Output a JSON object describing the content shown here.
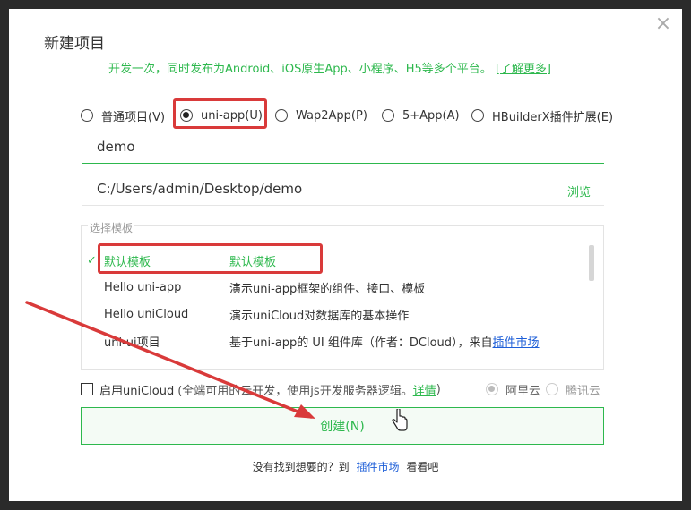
{
  "dialog": {
    "title": "新建项目",
    "subtitle": "开发一次，同时发布为Android、iOS原生App、小程序、H5等多个平台。",
    "learn_more": "[了解更多]",
    "close_icon": "×"
  },
  "project_types": [
    {
      "label": "普通项目(V)",
      "checked": false
    },
    {
      "label": "uni-app(U)",
      "checked": true
    },
    {
      "label": "Wap2App(P)",
      "checked": false
    },
    {
      "label": "5+App(A)",
      "checked": false
    },
    {
      "label": "HBuilderX插件扩展(E)",
      "checked": false
    }
  ],
  "name_input": {
    "value": "demo"
  },
  "path_input": {
    "value": "C:/Users/admin/Desktop/demo",
    "browse_label": "浏览"
  },
  "templates": {
    "legend": "选择模板",
    "items": [
      {
        "name": "默认模板",
        "desc": "默认模板",
        "selected": true
      },
      {
        "name": "Hello uni-app",
        "desc": "演示uni-app框架的组件、接口、模板",
        "selected": false
      },
      {
        "name": "Hello uniCloud",
        "desc": "演示uniCloud对数据库的基本操作",
        "selected": false
      },
      {
        "name": "uni-ui项目",
        "desc": "基于uni-app的 UI 组件库（作者：DCloud），来自",
        "link": "插件市场",
        "selected": false
      }
    ],
    "check_icon": "✓"
  },
  "unicloud": {
    "label": "启用uniCloud",
    "desc": "(全端可用的云开发，使用js开发服务器逻辑。",
    "link": "详情",
    "close_paren": ")",
    "providers": [
      {
        "label": "阿里云",
        "checked": true
      },
      {
        "label": "腾讯云",
        "checked": false
      }
    ]
  },
  "create_button": {
    "label": "创建(N)"
  },
  "footer": {
    "prefix": "没有找到想要的？到",
    "link": "插件市场",
    "suffix": "看看吧"
  },
  "colors": {
    "accent": "#2db84d",
    "annotation_red": "#d93a3a",
    "link_blue": "#1e5fd8"
  }
}
